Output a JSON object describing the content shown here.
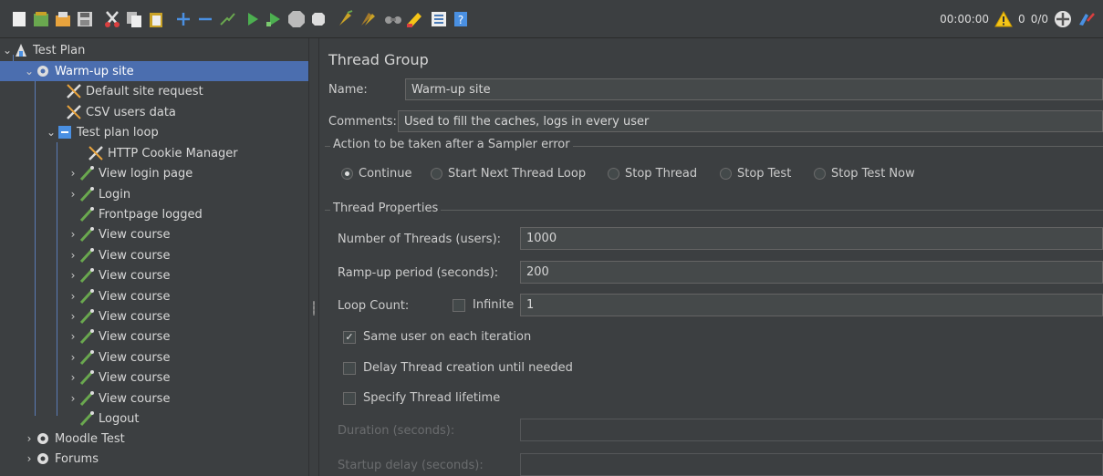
{
  "toolbar": {
    "icons": [
      "new-icon",
      "templates-icon",
      "open-icon",
      "save-icon",
      "cut-icon",
      "copy-icon",
      "paste-icon",
      "expand-icon",
      "collapse-icon",
      "toggle-icon",
      "start-icon",
      "start-no-pause-icon",
      "stop-icon",
      "shutdown-icon",
      "clear-icon",
      "clear-all-icon",
      "search-icon",
      "reset-search-icon",
      "function-helper-icon",
      "help-icon"
    ],
    "timer": "00:00:00",
    "warning_count": "0",
    "threads": "0/0"
  },
  "tree": {
    "test_plan": "Test Plan",
    "warmup": "Warm-up site",
    "default_request": "Default site request",
    "csv_users": "CSV users data",
    "loop": "Test plan loop",
    "cookie_manager": "HTTP Cookie Manager",
    "view_login": "View login page",
    "login": "Login",
    "frontpage": "Frontpage logged",
    "view_course": "View course",
    "logout": "Logout",
    "moodle_test": "Moodle Test",
    "forums": "Forums"
  },
  "panel": {
    "title": "Thread Group",
    "name_label": "Name:",
    "name_value": "Warm-up site",
    "comments_label": "Comments:",
    "comments_value": "Used to fill the caches, logs in every user",
    "error_group_title": "Action to be taken after a Sampler error",
    "error_actions": [
      "Continue",
      "Start Next Thread Loop",
      "Stop Thread",
      "Stop Test",
      "Stop Test Now"
    ],
    "selected_error_action": "Continue",
    "thread_props_title": "Thread Properties",
    "threads_label": "Number of Threads (users):",
    "threads_value": "1000",
    "rampup_label": "Ramp-up period (seconds):",
    "rampup_value": "200",
    "loop_label": "Loop Count:",
    "infinite_label": "Infinite",
    "infinite_checked": false,
    "loop_value": "1",
    "same_user_label": "Same user on each iteration",
    "same_user_checked": true,
    "delay_label": "Delay Thread creation until needed",
    "delay_checked": false,
    "lifetime_label": "Specify Thread lifetime",
    "lifetime_checked": false,
    "duration_label": "Duration (seconds):",
    "startup_delay_label": "Startup delay (seconds):"
  },
  "colors": {
    "selection": "#4b6eaf",
    "background": "#3c3f41",
    "warning": "#f5c518",
    "start": "#4caf50"
  }
}
